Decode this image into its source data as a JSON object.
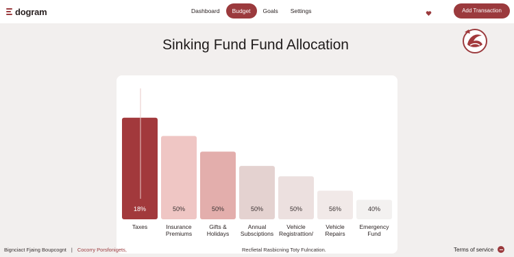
{
  "app": {
    "name": "dogram"
  },
  "nav": {
    "tabs": [
      {
        "label": "Dashboard",
        "active": false
      },
      {
        "label": "Budget",
        "active": true
      },
      {
        "label": "Goals",
        "active": false
      },
      {
        "label": "Settings",
        "active": false
      }
    ],
    "add_button_label": "Add Transaction"
  },
  "page": {
    "title": "Sinking Fund Fund Allocation"
  },
  "colors": {
    "accent": "#9b3a3d",
    "page_bg": "#f2efee",
    "bar_fills": [
      "#a2393c",
      "#efc6c4",
      "#e3aeac",
      "#e4d2d0",
      "#ece0df",
      "#f1e9e8",
      "#f3f1f0"
    ]
  },
  "chart_data": {
    "type": "bar",
    "categories": [
      [
        "Taxes"
      ],
      [
        "Insurance",
        "Premiums"
      ],
      [
        "Gifts &",
        "Holidays"
      ],
      [
        "Annual",
        "Subsciptions"
      ],
      [
        "Vehicle",
        "Registrattion/"
      ],
      [
        "Vehicle",
        "Repairs"
      ],
      [
        "Emergency",
        "Fund"
      ]
    ],
    "values": [
      78,
      64,
      52,
      41,
      33,
      22,
      15
    ],
    "data_labels": [
      "18%",
      "50%",
      "50%",
      "50%",
      "50%",
      "56%",
      "40%"
    ],
    "ylim": [
      0,
      100
    ],
    "grid": false,
    "title": "",
    "xlabel": "",
    "ylabel": ""
  },
  "footer": {
    "left_text": "Bignciact Fjaing Boupcognt",
    "left_separator": "|",
    "left_accent_text": "Cocorry Porsfonigets,",
    "center_text": "Recfietal Rasbicning Toty Fulncation.",
    "terms_label": "Terms of service"
  }
}
